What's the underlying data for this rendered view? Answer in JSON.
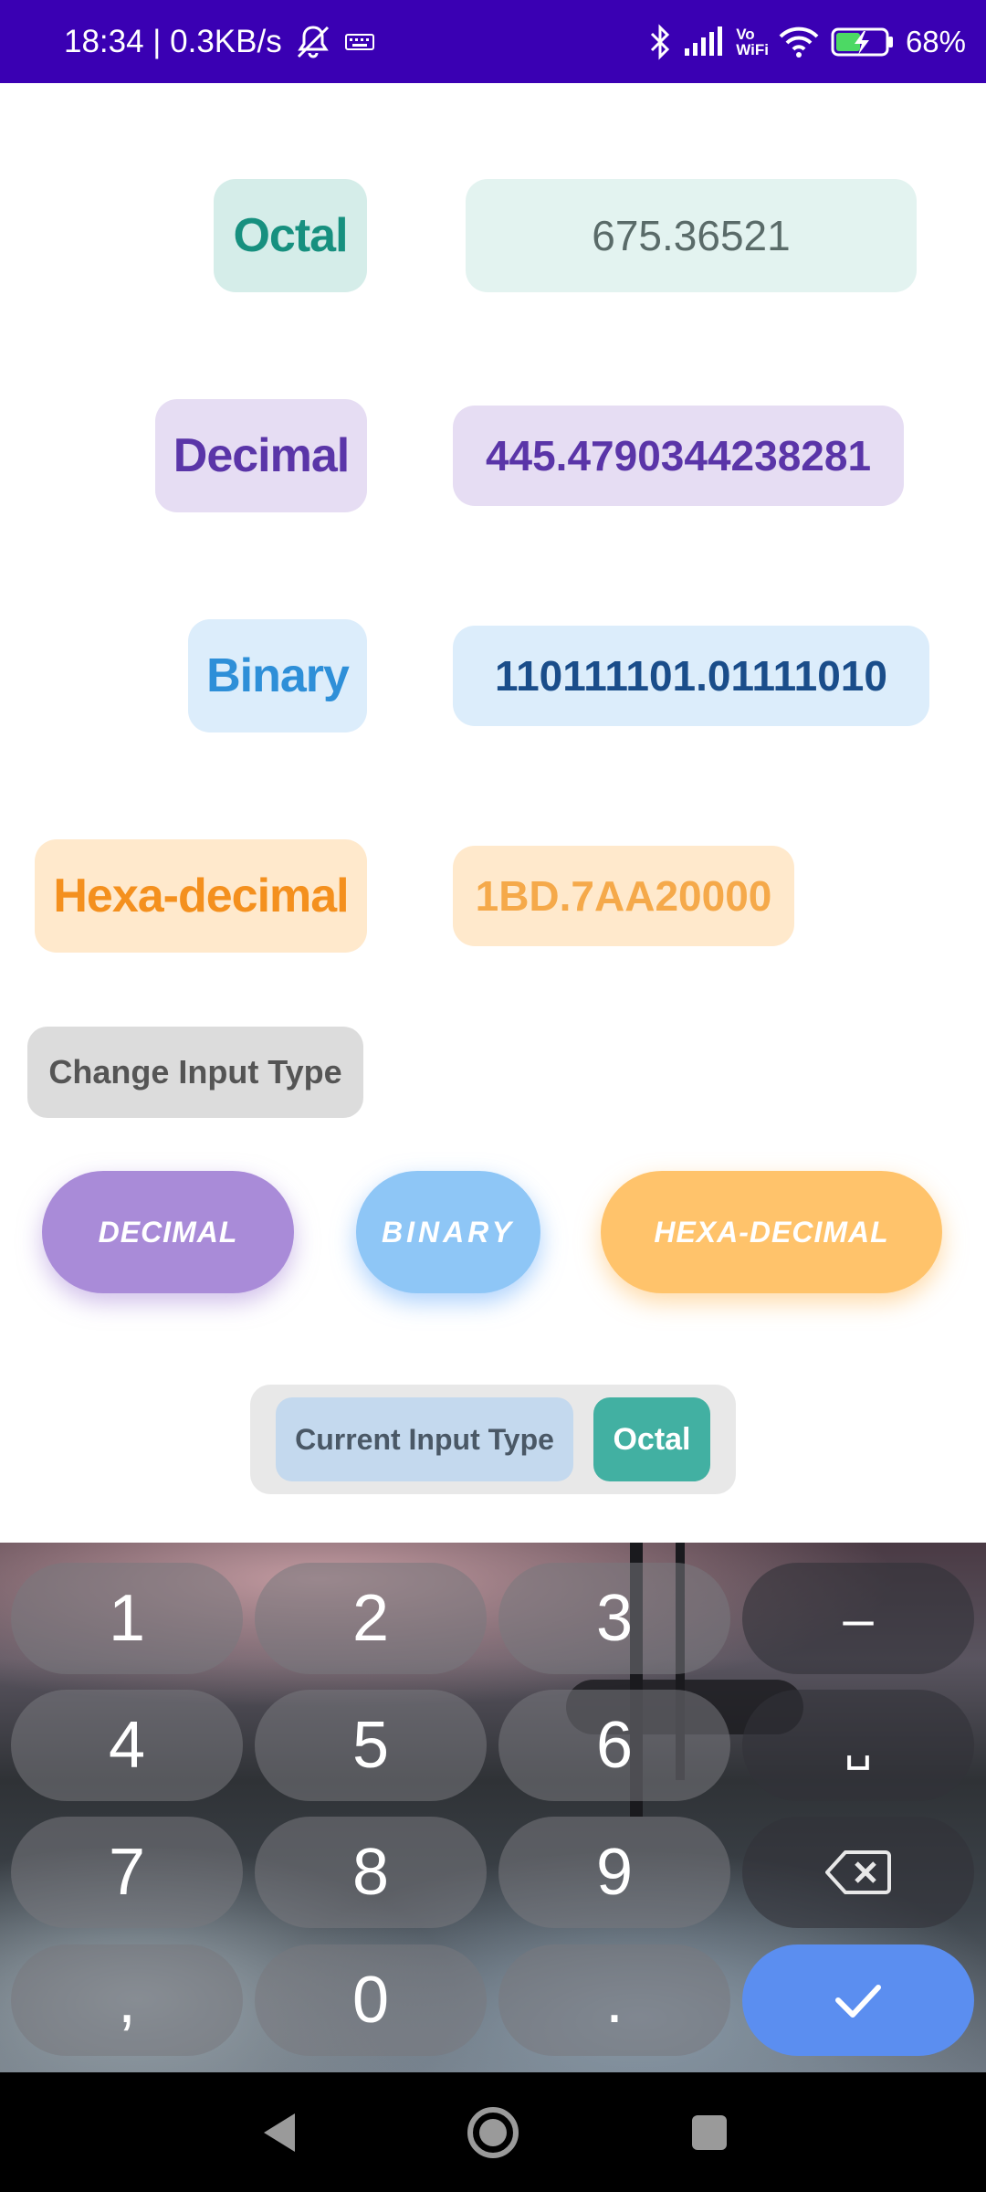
{
  "status_bar": {
    "time_speed": "18:34 | 0.3KB/s",
    "network_label_top": "Vo",
    "network_label_bottom": "WiFi",
    "battery": "68%"
  },
  "rows": {
    "octal": {
      "label": "Octal",
      "value": "675.36521"
    },
    "decimal": {
      "label": "Decimal",
      "value": "445.4790344238281"
    },
    "binary": {
      "label": "Binary",
      "value": "110111101.01111010"
    },
    "hex": {
      "label": "Hexa-decimal",
      "value": "1BD.7AA20000"
    }
  },
  "change_input_type": "Change Input Type",
  "type_buttons": {
    "decimal": "DECIMAL",
    "binary": "BINARY",
    "hex": "HEXA-DECIMAL"
  },
  "current": {
    "label": "Current Input Type",
    "value": "Octal"
  },
  "keyboard": {
    "keys": [
      "1",
      "2",
      "3",
      "–",
      "4",
      "5",
      "6",
      "␣",
      "7",
      "8",
      "9",
      "⌫",
      ",",
      "0",
      ".",
      "✓"
    ]
  },
  "colors": {
    "status_bar": "#3a00b3",
    "octal": "#17907f",
    "decimal": "#5a35a8",
    "binary": "#2e8fd8",
    "hex": "#f4901e",
    "confirm_key": "#5b8ef0"
  },
  "icons": [
    "mute-icon",
    "keyboard-icon",
    "bluetooth-icon",
    "signal-icon",
    "wifi-icon",
    "battery-icon",
    "back-icon",
    "home-icon",
    "recents-icon",
    "backspace-icon",
    "check-icon"
  ]
}
